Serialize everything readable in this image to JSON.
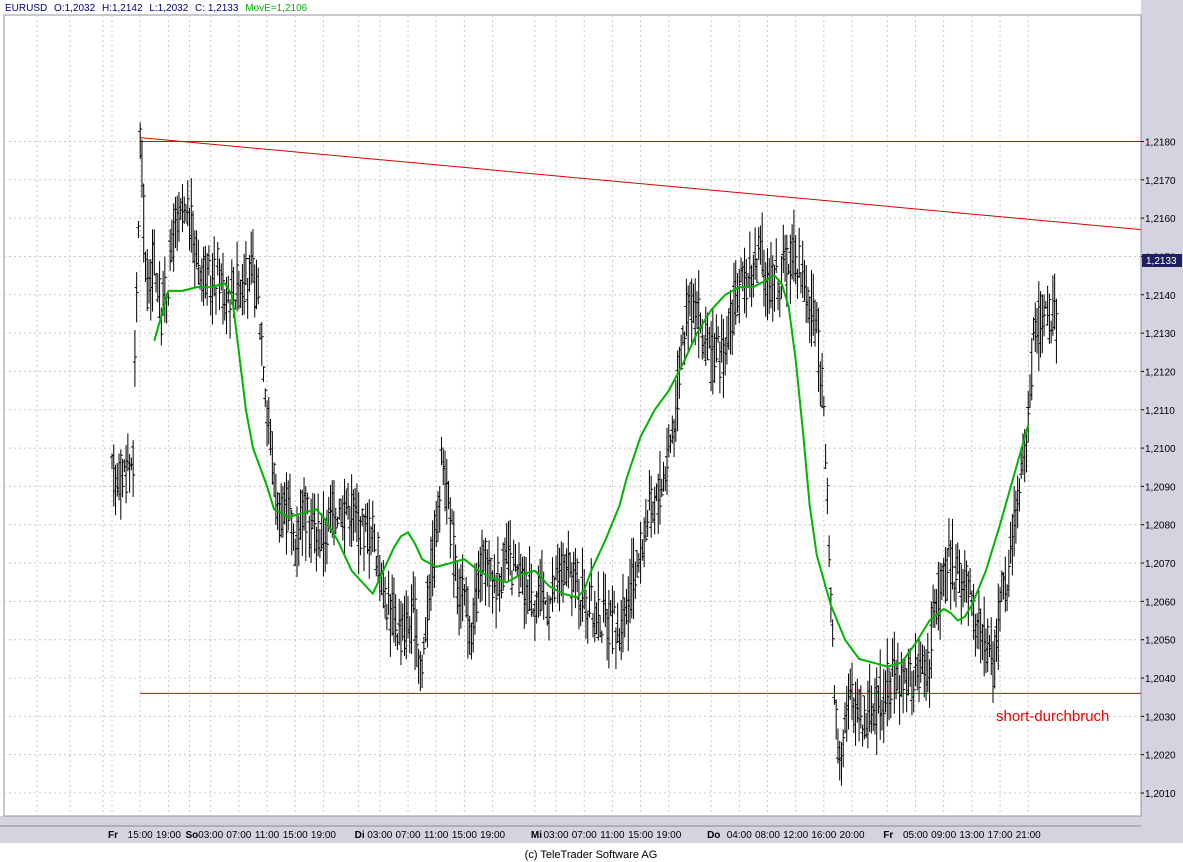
{
  "legend": {
    "symbol": "EURUSD",
    "open": "O:1,2032",
    "high": "H:1,2142",
    "low": "L:1,2032",
    "close": "C: 1,2133",
    "ma": "MovE=1,2106"
  },
  "copyright": "(c) TeleTrader Software AG",
  "annotation": "short-durchbruch",
  "last_price_label": "1,2133",
  "colors": {
    "background": "#ffffff",
    "grid": "#c8c8c8",
    "frame": "#d4d4e0",
    "bars": "#000000",
    "moving_average": "#00b400",
    "trendlines": "#dd0000",
    "annotation": "#ee0000",
    "price_tag": "#202060"
  },
  "chart_data": {
    "type": "ohlc",
    "instrument": "EURUSD",
    "y_ticks": [
      "1,2010",
      "1,2020",
      "1,2030",
      "1,2040",
      "1,2050",
      "1,2060",
      "1,2070",
      "1,2080",
      "1,2090",
      "1,2100",
      "1,2110",
      "1,2120",
      "1,2130",
      "1,2140",
      "1,2150",
      "1,2160",
      "1,2170",
      "1,2180"
    ],
    "y_tick_values": [
      1.201,
      1.202,
      1.203,
      1.204,
      1.205,
      1.206,
      1.207,
      1.208,
      1.209,
      1.21,
      1.211,
      1.212,
      1.213,
      1.214,
      1.215,
      1.216,
      1.217,
      1.218
    ],
    "ylim": [
      1.2004,
      1.2213
    ],
    "x_range": [
      0,
      146
    ],
    "x_ticks": [
      {
        "label": "Fr",
        "x": 0,
        "day": true
      },
      {
        "label": "15:00",
        "x": 4
      },
      {
        "label": "19:00",
        "x": 8
      },
      {
        "label": "So",
        "x": 11,
        "day": true
      },
      {
        "label": "03:00",
        "x": 14
      },
      {
        "label": "07:00",
        "x": 18
      },
      {
        "label": "11:00",
        "x": 22
      },
      {
        "label": "15:00",
        "x": 26
      },
      {
        "label": "19:00",
        "x": 30
      },
      {
        "label": "Di",
        "x": 35,
        "day": true
      },
      {
        "label": "03:00",
        "x": 38
      },
      {
        "label": "07:00",
        "x": 42
      },
      {
        "label": "11:00",
        "x": 46
      },
      {
        "label": "15:00",
        "x": 50
      },
      {
        "label": "19:00",
        "x": 54
      },
      {
        "label": "Mi",
        "x": 60,
        "day": true
      },
      {
        "label": "03:00",
        "x": 63
      },
      {
        "label": "07:00",
        "x": 67
      },
      {
        "label": "11:00",
        "x": 71
      },
      {
        "label": "15:00",
        "x": 75
      },
      {
        "label": "19:00",
        "x": 79
      },
      {
        "label": "Do",
        "x": 85,
        "day": true
      },
      {
        "label": "04:00",
        "x": 89
      },
      {
        "label": "08:00",
        "x": 93
      },
      {
        "label": "12:00",
        "x": 97
      },
      {
        "label": "16:00",
        "x": 101
      },
      {
        "label": "20:00",
        "x": 105
      },
      {
        "label": "Fr",
        "x": 110,
        "day": true
      },
      {
        "label": "05:00",
        "x": 114
      },
      {
        "label": "09:00",
        "x": 118
      },
      {
        "label": "13:00",
        "x": 122
      },
      {
        "label": "17:00",
        "x": 126
      },
      {
        "label": "21:00",
        "x": 130
      }
    ],
    "price_path": [
      [
        0,
        1.2093
      ],
      [
        2,
        1.2094
      ],
      [
        3,
        1.2098
      ],
      [
        4,
        1.2181
      ],
      [
        5,
        1.214
      ],
      [
        6,
        1.215
      ],
      [
        7,
        1.2135
      ],
      [
        8,
        1.2145
      ],
      [
        9,
        1.2158
      ],
      [
        11,
        1.216
      ],
      [
        12,
        1.215
      ],
      [
        13,
        1.2147
      ],
      [
        14,
        1.2142
      ],
      [
        15,
        1.2147
      ],
      [
        16,
        1.214
      ],
      [
        18,
        1.2143
      ],
      [
        20,
        1.2145
      ],
      [
        21,
        1.2135
      ],
      [
        22,
        1.2112
      ],
      [
        23,
        1.2092
      ],
      [
        24,
        1.208
      ],
      [
        25,
        1.2085
      ],
      [
        26,
        1.2075
      ],
      [
        27,
        1.2085
      ],
      [
        28,
        1.208
      ],
      [
        30,
        1.2077
      ],
      [
        32,
        1.2085
      ],
      [
        34,
        1.2085
      ],
      [
        35,
        1.208
      ],
      [
        37,
        1.2078
      ],
      [
        39,
        1.206
      ],
      [
        41,
        1.2052
      ],
      [
        43,
        1.2055
      ],
      [
        44,
        1.2042
      ],
      [
        45,
        1.2065
      ],
      [
        46,
        1.2078
      ],
      [
        47,
        1.21
      ],
      [
        48,
        1.208
      ],
      [
        49,
        1.2065
      ],
      [
        50,
        1.206
      ],
      [
        51,
        1.205
      ],
      [
        52,
        1.2065
      ],
      [
        53,
        1.207
      ],
      [
        54,
        1.2065
      ],
      [
        56,
        1.207
      ],
      [
        58,
        1.2065
      ],
      [
        60,
        1.2062
      ],
      [
        62,
        1.206
      ],
      [
        64,
        1.2068
      ],
      [
        66,
        1.2065
      ],
      [
        68,
        1.2058
      ],
      [
        70,
        1.2055
      ],
      [
        72,
        1.2052
      ],
      [
        74,
        1.2065
      ],
      [
        76,
        1.2082
      ],
      [
        78,
        1.209
      ],
      [
        80,
        1.211
      ],
      [
        81,
        1.213
      ],
      [
        82,
        1.214
      ],
      [
        83,
        1.2135
      ],
      [
        84,
        1.2128
      ],
      [
        85,
        1.2123
      ],
      [
        87,
        1.2125
      ],
      [
        88,
        1.2135
      ],
      [
        89,
        1.214
      ],
      [
        90,
        1.2145
      ],
      [
        92,
        1.215
      ],
      [
        93,
        1.2143
      ],
      [
        95,
        1.2145
      ],
      [
        97,
        1.2152
      ],
      [
        98,
        1.2145
      ],
      [
        100,
        1.213
      ],
      [
        101,
        1.211
      ],
      [
        102,
        1.206
      ],
      [
        103,
        1.202
      ],
      [
        104,
        1.203
      ],
      [
        105,
        1.2035
      ],
      [
        107,
        1.203
      ],
      [
        109,
        1.2035
      ],
      [
        110,
        1.2038
      ],
      [
        112,
        1.204
      ],
      [
        114,
        1.204
      ],
      [
        116,
        1.2045
      ],
      [
        117,
        1.206
      ],
      [
        119,
        1.207
      ],
      [
        121,
        1.2065
      ],
      [
        122,
        1.2058
      ],
      [
        123,
        1.2055
      ],
      [
        124,
        1.205
      ],
      [
        125,
        1.2042
      ],
      [
        126,
        1.206
      ],
      [
        127,
        1.2065
      ],
      [
        128,
        1.208
      ],
      [
        129,
        1.2095
      ],
      [
        130,
        1.211
      ],
      [
        131,
        1.213
      ],
      [
        132,
        1.2135
      ],
      [
        134,
        1.2133
      ]
    ],
    "moving_average": [
      [
        6,
        1.2128
      ],
      [
        8,
        1.2141
      ],
      [
        10,
        1.2141
      ],
      [
        12,
        1.2142
      ],
      [
        14,
        1.2142
      ],
      [
        16,
        1.2143
      ],
      [
        17,
        1.214
      ],
      [
        18,
        1.2125
      ],
      [
        19,
        1.211
      ],
      [
        20,
        1.21
      ],
      [
        22,
        1.209
      ],
      [
        23,
        1.2084
      ],
      [
        25,
        1.2082
      ],
      [
        27,
        1.2083
      ],
      [
        29,
        1.2084
      ],
      [
        30,
        1.2082
      ],
      [
        32,
        1.2076
      ],
      [
        34,
        1.2068
      ],
      [
        36,
        1.2064
      ],
      [
        37,
        1.2062
      ],
      [
        38,
        1.2066
      ],
      [
        40,
        1.2074
      ],
      [
        41,
        1.2077
      ],
      [
        42,
        1.2078
      ],
      [
        43,
        1.2075
      ],
      [
        44,
        1.2071
      ],
      [
        46,
        1.2069
      ],
      [
        48,
        1.207
      ],
      [
        50,
        1.2071
      ],
      [
        52,
        1.2068
      ],
      [
        54,
        1.2066
      ],
      [
        56,
        1.2065
      ],
      [
        58,
        1.2067
      ],
      [
        60,
        1.2068
      ],
      [
        62,
        1.2064
      ],
      [
        64,
        1.2062
      ],
      [
        66,
        1.2061
      ],
      [
        67,
        1.2063
      ],
      [
        68,
        1.2068
      ],
      [
        70,
        1.2076
      ],
      [
        72,
        1.2085
      ],
      [
        73,
        1.2092
      ],
      [
        75,
        1.2103
      ],
      [
        77,
        1.211
      ],
      [
        79,
        1.2115
      ],
      [
        81,
        1.2122
      ],
      [
        83,
        1.213
      ],
      [
        85,
        1.2136
      ],
      [
        87,
        1.214
      ],
      [
        89,
        1.2142
      ],
      [
        91,
        1.2142
      ],
      [
        93,
        1.2144
      ],
      [
        94,
        1.2145
      ],
      [
        95,
        1.2143
      ],
      [
        96,
        1.2137
      ],
      [
        97,
        1.2123
      ],
      [
        98,
        1.2105
      ],
      [
        99,
        1.2085
      ],
      [
        100,
        1.2072
      ],
      [
        102,
        1.2059
      ],
      [
        104,
        1.205
      ],
      [
        106,
        1.2045
      ],
      [
        108,
        1.2044
      ],
      [
        110,
        1.2043
      ],
      [
        112,
        1.2044
      ],
      [
        114,
        1.2049
      ],
      [
        116,
        1.2055
      ],
      [
        118,
        1.2058
      ],
      [
        119,
        1.2057
      ],
      [
        120,
        1.2055
      ],
      [
        121,
        1.2056
      ],
      [
        122,
        1.2059
      ],
      [
        124,
        1.2068
      ],
      [
        126,
        1.208
      ],
      [
        128,
        1.2093
      ],
      [
        130,
        1.2106
      ]
    ],
    "trendlines": [
      {
        "x": [
          4,
          146
        ],
        "y": [
          1.218,
          1.218
        ]
      },
      {
        "x": [
          4,
          146
        ],
        "y": [
          1.2036,
          1.2036
        ]
      },
      {
        "x": [
          4,
          146
        ],
        "y": [
          1.2181,
          1.2157
        ]
      }
    ],
    "grid": true
  }
}
